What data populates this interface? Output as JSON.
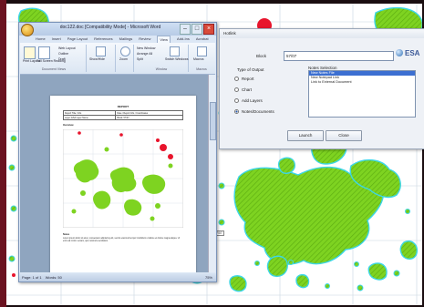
{
  "word": {
    "title": "doc122.doc [Compatibility Mode] - Microsoft Word",
    "tabs": [
      "Home",
      "Insert",
      "Page Layout",
      "References",
      "Mailings",
      "Review",
      "View",
      "Add-Ins",
      "Acrobat"
    ],
    "active_tab": "View",
    "ribbon": {
      "print_layout": "Print Layout",
      "full_screen": "Full Screen Reading",
      "web_layout": "Web Layout",
      "outline": "Outline",
      "draft": "Draft",
      "show_hide": "Show/Hide",
      "zoom": "Zoom",
      "new_window": "New Window",
      "arrange_all": "Arrange All",
      "split": "Split",
      "switch_windows": "Switch Windows",
      "macros": "Macros",
      "group_views": "Document Views",
      "group_window": "Window",
      "group_macros": "Macros"
    },
    "status": {
      "page": "Page: 1 of 1",
      "words": "Words: 50",
      "zoom": "75%"
    },
    "page": {
      "title": "REPORT",
      "table": [
        [
          "Report Title / Info",
          "Date / Report Info / Coordinates"
        ],
        [
          "Layer: ESA Layer Name",
          "Block: 57/07"
        ]
      ],
      "section_overview": "Overview",
      "section_notes": "Notes",
      "notes_text": "Lorem ipsum dolor sit amet, consectetur adipiscing elit, sed do eiusmod tempor incididunt ut labore et dolore magna aliqua. Ut enim ad minim veniam, quis nostrud exercitation."
    }
  },
  "dialog": {
    "title": "Hotlink",
    "block_label": "Block",
    "block_value": "57/07",
    "brand": "ESA",
    "output_group": "Type of Output",
    "options": [
      "Report",
      "Chart",
      "Add Layers",
      "Notes/Documents"
    ],
    "selected_option": "Notes/Documents",
    "notes_group": "Notes Selection",
    "notes": [
      "New Notes File",
      "New Notepad Link",
      "Link to External Document"
    ],
    "selected_note": "New Notes File",
    "launch_label": "Launch",
    "close_label": "Close"
  },
  "map": {
    "label": "57/07",
    "colors": {
      "habitat": "#7ed321",
      "outline": "#3cd6e6",
      "feature": "#e8142c",
      "grid": "#c8d6e0",
      "frame": "#6b1220"
    }
  }
}
